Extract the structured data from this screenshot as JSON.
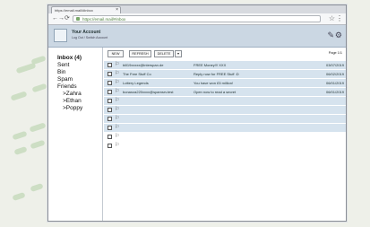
{
  "browser": {
    "tab_title": "https://email.mail/#inbox",
    "url": "https://email.mail/#inbox"
  },
  "account": {
    "title": "Your Account",
    "subtitle": "Log Out / Switch Account"
  },
  "folders": [
    {
      "label": "Inbox (4)",
      "indent": 0,
      "bold": true
    },
    {
      "label": "Sent",
      "indent": 0,
      "bold": false
    },
    {
      "label": "Bin",
      "indent": 0,
      "bold": false
    },
    {
      "label": "Spam",
      "indent": 0,
      "bold": false
    },
    {
      "label": "Friends",
      "indent": 0,
      "bold": false
    },
    {
      "label": ">Zahra",
      "indent": 1,
      "bold": false
    },
    {
      "label": ">Ethan",
      "indent": 1,
      "bold": false
    },
    {
      "label": ">Poppy",
      "indent": 1,
      "bold": false
    }
  ],
  "toolbar": {
    "new_label": "NEW",
    "refresh_label": "REFRESH",
    "delete_label": "DELETE",
    "page_label": "Page 1/1"
  },
  "emails": [
    {
      "from": "bill19xxxxx@interspan.de",
      "subject": "FREE Money!!! XXX",
      "date": "03/07/2019"
    },
    {
      "from": "The Free Stuff Co",
      "subject": "Reply now for FREE Stuff :D",
      "date": "06/02/2019"
    },
    {
      "from": "Lottery Legends",
      "subject": "You have won £5 million!",
      "date": "06/01/2019"
    },
    {
      "from": "bonanza220xxxx@spamsrv.test",
      "subject": "Open now to read a secret",
      "date": "06/01/2019"
    }
  ],
  "empty_rows": 6,
  "colors": {
    "header_bg": "#cbd7e3",
    "row_bg": "#d6e3ee"
  }
}
